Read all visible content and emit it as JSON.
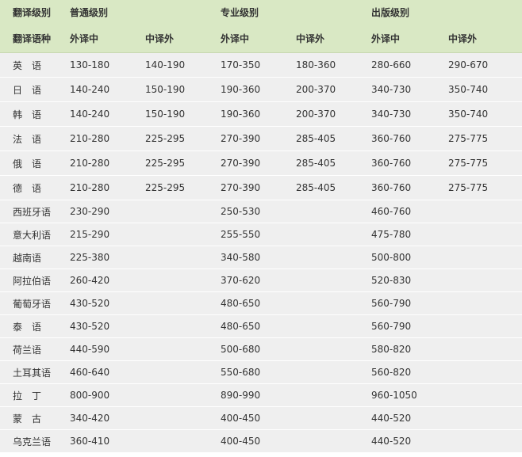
{
  "header": {
    "row1": {
      "level_label": "翻译级别",
      "ordinary": "普通级别",
      "professional": "专业级别",
      "publishing": "出版级别"
    },
    "row2": {
      "language_label": "翻译语种",
      "ordinary_f2c": "外译中",
      "ordinary_c2f": "中译外",
      "professional_f2c": "外译中",
      "professional_c2f": "中译外",
      "publishing_f2c": "外译中",
      "publishing_c2f": "中译外"
    }
  },
  "rows": [
    {
      "lang": "英　语",
      "ord_f2c": "130-180",
      "ord_c2f": "140-190",
      "pro_f2c": "170-350",
      "pro_c2f": "180-360",
      "pub_f2c": "280-660",
      "pub_c2f": "290-670"
    },
    {
      "lang": "日　语",
      "ord_f2c": "140-240",
      "ord_c2f": "150-190",
      "pro_f2c": "190-360",
      "pro_c2f": "200-370",
      "pub_f2c": "340-730",
      "pub_c2f": "350-740"
    },
    {
      "lang": "韩　语",
      "ord_f2c": "140-240",
      "ord_c2f": "150-190",
      "pro_f2c": "190-360",
      "pro_c2f": "200-370",
      "pub_f2c": "340-730",
      "pub_c2f": "350-740"
    },
    {
      "lang": "法　语",
      "ord_f2c": "210-280",
      "ord_c2f": "225-295",
      "pro_f2c": "270-390",
      "pro_c2f": "285-405",
      "pub_f2c": "360-760",
      "pub_c2f": "275-775"
    },
    {
      "lang": "俄　语",
      "ord_f2c": "210-280",
      "ord_c2f": "225-295",
      "pro_f2c": "270-390",
      "pro_c2f": "285-405",
      "pub_f2c": "360-760",
      "pub_c2f": "275-775"
    },
    {
      "lang": "德　语",
      "ord_f2c": "210-280",
      "ord_c2f": "225-295",
      "pro_f2c": "270-390",
      "pro_c2f": "285-405",
      "pub_f2c": "360-760",
      "pub_c2f": "275-775"
    },
    {
      "lang": "西班牙语",
      "ord_f2c": "230-290",
      "ord_c2f": "",
      "pro_f2c": "250-530",
      "pro_c2f": "",
      "pub_f2c": "460-760",
      "pub_c2f": ""
    },
    {
      "lang": "意大利语",
      "ord_f2c": "215-290",
      "ord_c2f": "",
      "pro_f2c": "255-550",
      "pro_c2f": "",
      "pub_f2c": "475-780",
      "pub_c2f": ""
    },
    {
      "lang": "越南语",
      "ord_f2c": "225-380",
      "ord_c2f": "",
      "pro_f2c": "340-580",
      "pro_c2f": "",
      "pub_f2c": "500-800",
      "pub_c2f": ""
    },
    {
      "lang": "阿拉伯语",
      "ord_f2c": "260-420",
      "ord_c2f": "",
      "pro_f2c": "370-620",
      "pro_c2f": "",
      "pub_f2c": "520-830",
      "pub_c2f": ""
    },
    {
      "lang": "葡萄牙语",
      "ord_f2c": "430-520",
      "ord_c2f": "",
      "pro_f2c": "480-650",
      "pro_c2f": "",
      "pub_f2c": "560-790",
      "pub_c2f": ""
    },
    {
      "lang": "泰　语",
      "ord_f2c": "430-520",
      "ord_c2f": "",
      "pro_f2c": "480-650",
      "pro_c2f": "",
      "pub_f2c": "560-790",
      "pub_c2f": ""
    },
    {
      "lang": "荷兰语",
      "ord_f2c": "440-590",
      "ord_c2f": "",
      "pro_f2c": "500-680",
      "pro_c2f": "",
      "pub_f2c": "580-820",
      "pub_c2f": ""
    },
    {
      "lang": "土耳其语",
      "ord_f2c": "460-640",
      "ord_c2f": "",
      "pro_f2c": "550-680",
      "pro_c2f": "",
      "pub_f2c": "560-820",
      "pub_c2f": ""
    },
    {
      "lang": "拉　丁",
      "ord_f2c": "800-900",
      "ord_c2f": "",
      "pro_f2c": "890-990",
      "pro_c2f": "",
      "pub_f2c": "960-1050",
      "pub_c2f": ""
    },
    {
      "lang": "蒙　古",
      "ord_f2c": "340-420",
      "ord_c2f": "",
      "pro_f2c": "400-450",
      "pro_c2f": "",
      "pub_f2c": "440-520",
      "pub_c2f": ""
    },
    {
      "lang": "乌克兰语",
      "ord_f2c": "360-410",
      "ord_c2f": "",
      "pro_f2c": "400-450",
      "pro_c2f": "",
      "pub_f2c": "440-520",
      "pub_c2f": ""
    }
  ]
}
